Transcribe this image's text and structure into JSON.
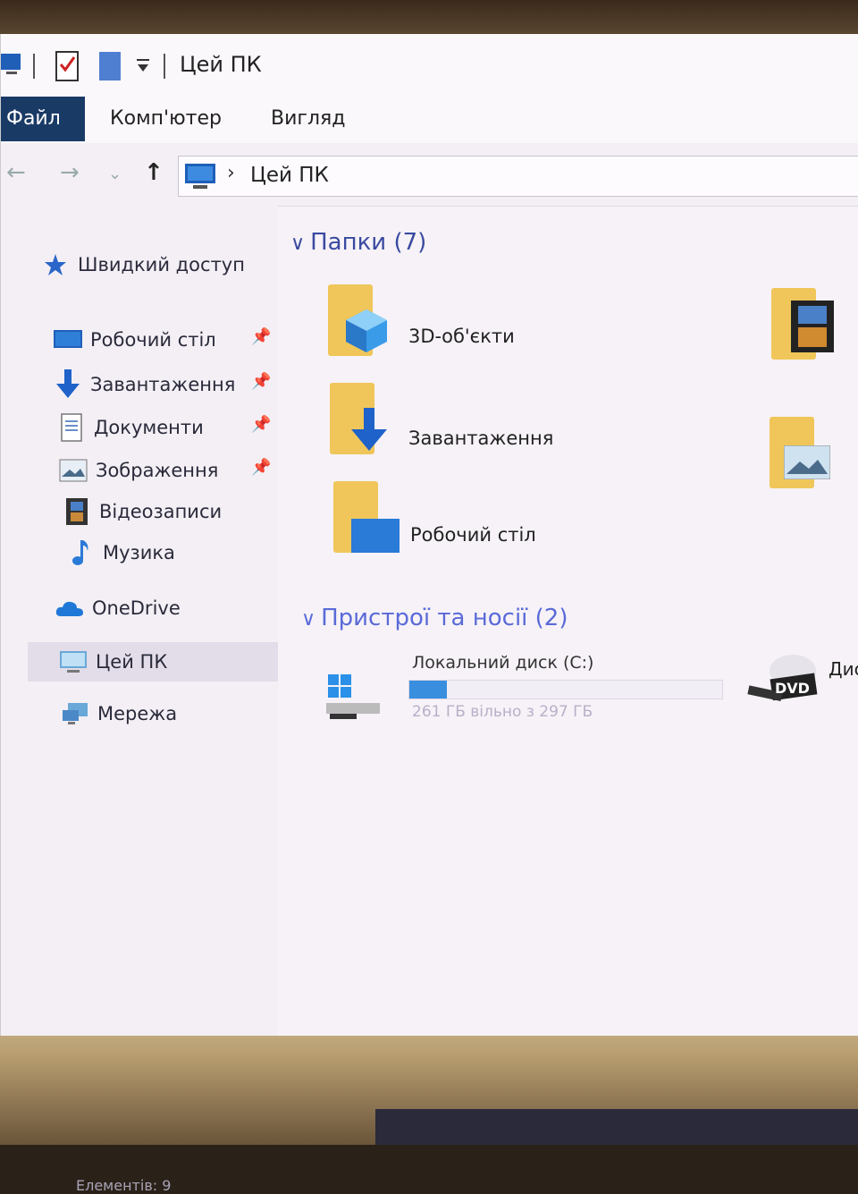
{
  "window": {
    "title": "Цей ПК"
  },
  "ribbon": {
    "tabs": [
      "Файл",
      "Комп'ютер",
      "Вигляд"
    ]
  },
  "address": {
    "path": "Цей ПК"
  },
  "sidebar": {
    "quick_access": "Швидкий доступ",
    "items": [
      {
        "label": "Робочий стіл",
        "icon": "desktop-icon",
        "pinned": true
      },
      {
        "label": "Завантаження",
        "icon": "download-icon",
        "pinned": true
      },
      {
        "label": "Документи",
        "icon": "documents-icon",
        "pinned": true
      },
      {
        "label": "Зображення",
        "icon": "pictures-icon",
        "pinned": true
      },
      {
        "label": "Відеозаписи",
        "icon": "videos-icon",
        "pinned": false
      },
      {
        "label": "Музика",
        "icon": "music-icon",
        "pinned": false
      }
    ],
    "onedrive": "OneDrive",
    "this_pc": "Цей ПК",
    "network": "Мережа"
  },
  "main": {
    "folders_header": "Папки (7)",
    "folders": [
      {
        "label": "3D-об'єкти"
      },
      {
        "label": "Завантаження"
      },
      {
        "label": "Робочий стіл"
      }
    ],
    "devices_header": "Пристрої та носії (2)",
    "drive": {
      "label": "Локальний диск (C:)",
      "free": "261 ГБ вільно з 297 ГБ",
      "used_fraction": 0.12
    },
    "dvd": {
      "label": "DVD",
      "name_partial": "Дис"
    }
  },
  "status": {
    "items": "Елементів: 9"
  },
  "colors": {
    "accent": "#1a3a66",
    "folder": "#f0c65a",
    "link": "#3a4aa0"
  }
}
